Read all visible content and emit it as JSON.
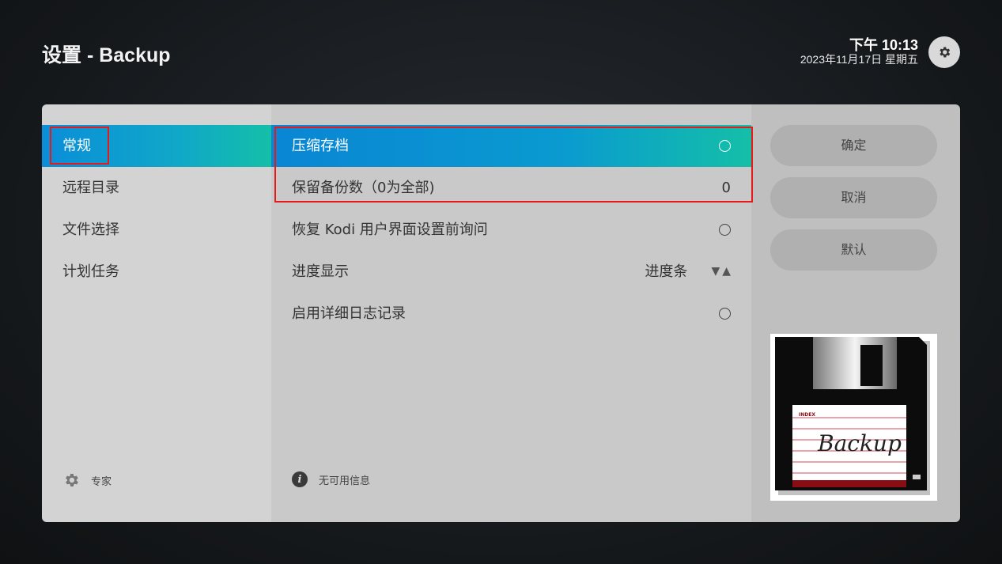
{
  "header": {
    "title": "设置 - Backup",
    "time": "下午 10:13",
    "date": "2023年11月17日 星期五"
  },
  "categories": [
    {
      "label": "常规",
      "active": true
    },
    {
      "label": "远程目录",
      "active": false
    },
    {
      "label": "文件选择",
      "active": false
    },
    {
      "label": "计划任务",
      "active": false
    }
  ],
  "expert_label": "专家",
  "settings": [
    {
      "label": "压缩存档",
      "control": "radio",
      "active": true
    },
    {
      "label": "保留备份数（0为全部)",
      "value": "0"
    },
    {
      "label": "恢复 Kodi 用户界面设置前询问",
      "control": "radio"
    },
    {
      "label": "进度显示",
      "value": "进度条",
      "control": "spinner"
    },
    {
      "label": "启用详细日志记录",
      "control": "radio"
    }
  ],
  "info_text": "无可用信息",
  "buttons": {
    "ok": "确定",
    "cancel": "取消",
    "default": "默认"
  },
  "thumbnail": {
    "index_label": "INDEX",
    "handwritten": "Backup"
  },
  "colors": {
    "accent": "#0a8ed9",
    "accent_end": "#14bfa8",
    "highlight": "#e8191b"
  }
}
